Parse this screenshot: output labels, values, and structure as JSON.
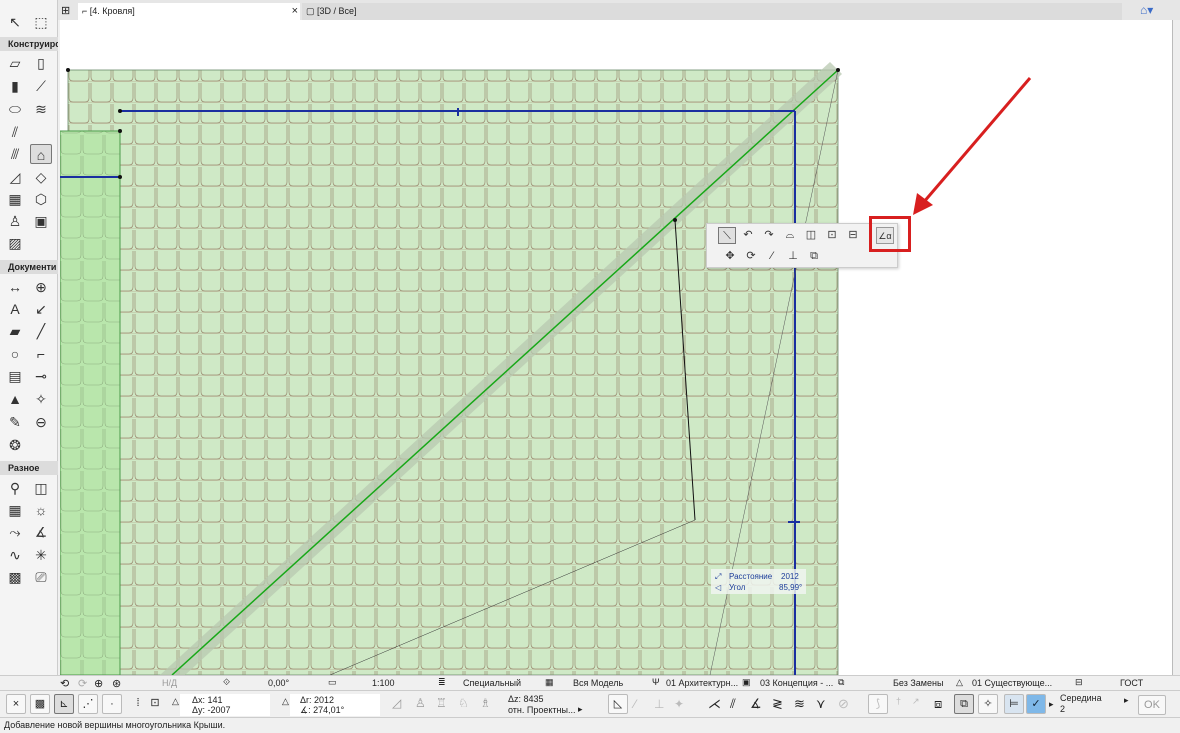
{
  "tabs": [
    {
      "label": "[4. Кровля]",
      "close": "×"
    },
    {
      "label": "[3D / Все]"
    }
  ],
  "sidebar": {
    "sections": [
      {
        "label": "Конструирс"
      },
      {
        "label": "Документи"
      },
      {
        "label": "Разное"
      }
    ]
  },
  "popup": {
    "row1": [
      "⟍",
      "↶",
      "↷",
      "⌓",
      "◫",
      "⊡",
      "⊟"
    ],
    "row2": [
      "✥",
      "⟳",
      "⁄",
      "⊥",
      "⧉"
    ],
    "highlighted_icon": "∠α"
  },
  "tracker": {
    "distance_label": "Расстояние",
    "distance_value": "2012",
    "angle_label": "Угол",
    "angle_value": "85,99°"
  },
  "infobar": {
    "nd": "Н/Д",
    "angle": "0,00°",
    "scale": "1:100",
    "layer_combo": "Специальный",
    "model": "Вся Модель",
    "pen": "01 Архитектурн...",
    "view": "03 Концепция - ...",
    "override": "Без Замены",
    "renovation": "01 Существующе...",
    "standard": "ГОСТ"
  },
  "coords": {
    "dx": "Δx: 141",
    "dy": "Δy: -2007",
    "dr": "Δr: 2012",
    "da": "∡: 274,01°",
    "dz": "Δz: 8435",
    "ref": "отн. Проектны...",
    "snap_label": "Середина",
    "snap_value": "2",
    "ok": "OK"
  },
  "status": "Добавление новой вершины многоугольника Крыши.",
  "colors": {
    "roof_fill": "#cfe9c6",
    "tile_line": "#9b8a70",
    "ridge": "#18a818",
    "edge": "#1a2ea0",
    "highlight": "#d81f1f"
  }
}
